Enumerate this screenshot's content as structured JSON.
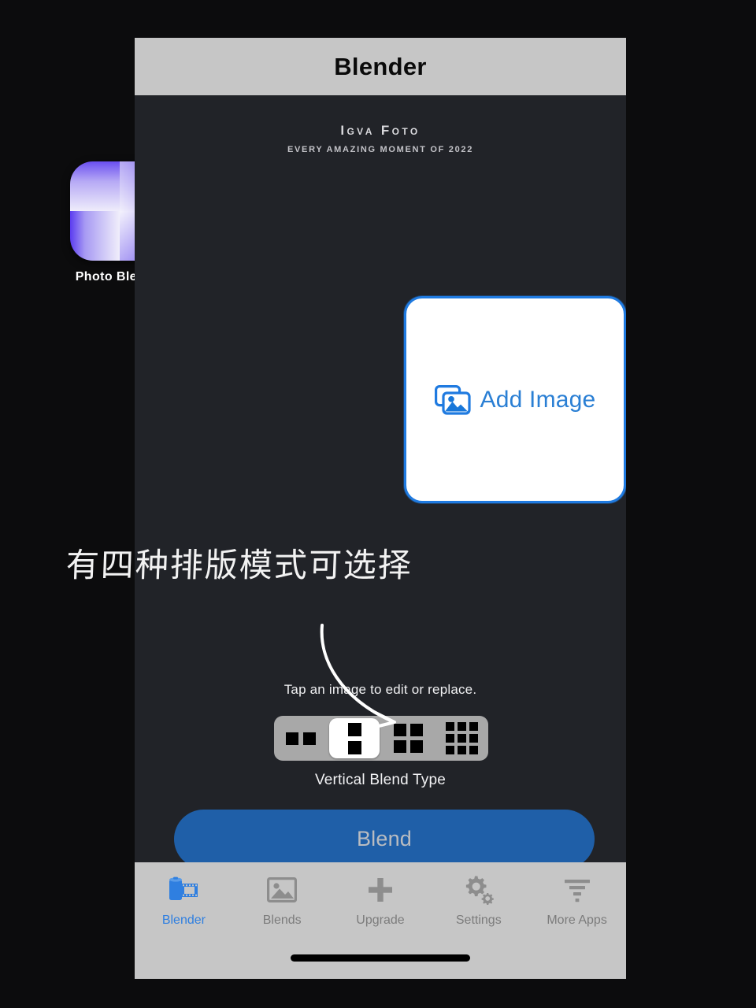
{
  "desktop": {
    "app_icon": {
      "name": "photo-blender-icon",
      "label": "Photo Blender"
    }
  },
  "phone": {
    "header": {
      "title": "Blender"
    },
    "brand": {
      "title": "Igva Foto",
      "subtitle": "Every amazing moment of 2022"
    },
    "add_image_card": {
      "label": "Add Image",
      "icon": "photos-stack-icon",
      "border_color": "#1f7ae0",
      "text_color": "#2a7fd4"
    },
    "annotation": {
      "text": "有四种排版模式可选择",
      "arrow": "curved-arrow-icon",
      "color": "#f2f2f2"
    },
    "hint": "Tap an image to edit or replace.",
    "segmented_control": {
      "caption": "Vertical Blend Type",
      "selected_index": 1,
      "options": [
        {
          "name": "layout-2-horizontal",
          "icon": "two-panes-horizontal-icon",
          "cells": 2
        },
        {
          "name": "layout-2-vertical",
          "icon": "two-panes-vertical-icon",
          "cells": 2
        },
        {
          "name": "layout-4-grid",
          "icon": "four-panes-grid-icon",
          "cells": 4
        },
        {
          "name": "layout-9-grid",
          "icon": "nine-panes-grid-icon",
          "cells": 9
        }
      ],
      "track_color": "#a8a8a8",
      "selected_bg": "#ffffff"
    },
    "blend_button": {
      "label": "Blend",
      "background": "#1f5fa8",
      "text_color": "#b9bcc1"
    },
    "tabbar": {
      "active_index": 0,
      "active_color": "#2f7fe0",
      "inactive_color": "#7c7c7c",
      "tabs": [
        {
          "label": "Blender",
          "icon": "film-roll-icon"
        },
        {
          "label": "Blends",
          "icon": "image-icon"
        },
        {
          "label": "Upgrade",
          "icon": "plus-icon"
        },
        {
          "label": "Settings",
          "icon": "gears-icon"
        },
        {
          "label": "More Apps",
          "icon": "funnel-icon"
        }
      ]
    }
  }
}
